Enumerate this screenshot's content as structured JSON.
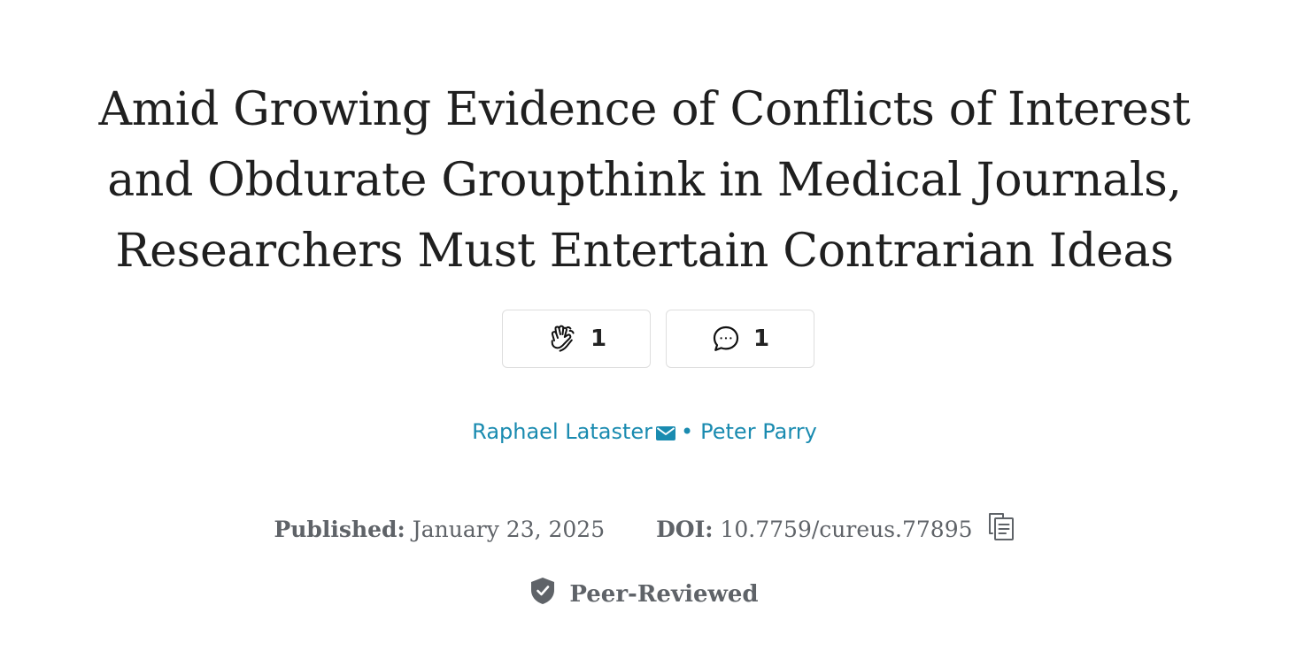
{
  "article": {
    "title_lines": [
      "Amid Growing Evidence of Conflicts of Interest",
      "and Obdurate Groupthink in Medical Journals,",
      "Researchers Must Entertain Contrarian Ideas"
    ]
  },
  "actions": {
    "claps": {
      "icon": "clap-icon",
      "count": "1"
    },
    "comments": {
      "icon": "comment-icon",
      "count": "1"
    }
  },
  "authors": [
    {
      "name": "Raphael Lataster",
      "icon": "mail-icon"
    },
    {
      "name": "Peter Parry"
    }
  ],
  "author_separator": "•",
  "meta": {
    "published_label": "Published:",
    "published_date": "January 23, 2025",
    "doi_label": "DOI:",
    "doi_value": "10.7759/cureus.77895",
    "copy_icon": "copy-icon"
  },
  "peer_review": {
    "icon": "shield-check-icon",
    "label": "Peer-Reviewed"
  },
  "colors": {
    "author_link": "#1a8bb0",
    "title": "#1f1f1f",
    "meta": "#5f6368",
    "border": "#dedede"
  }
}
